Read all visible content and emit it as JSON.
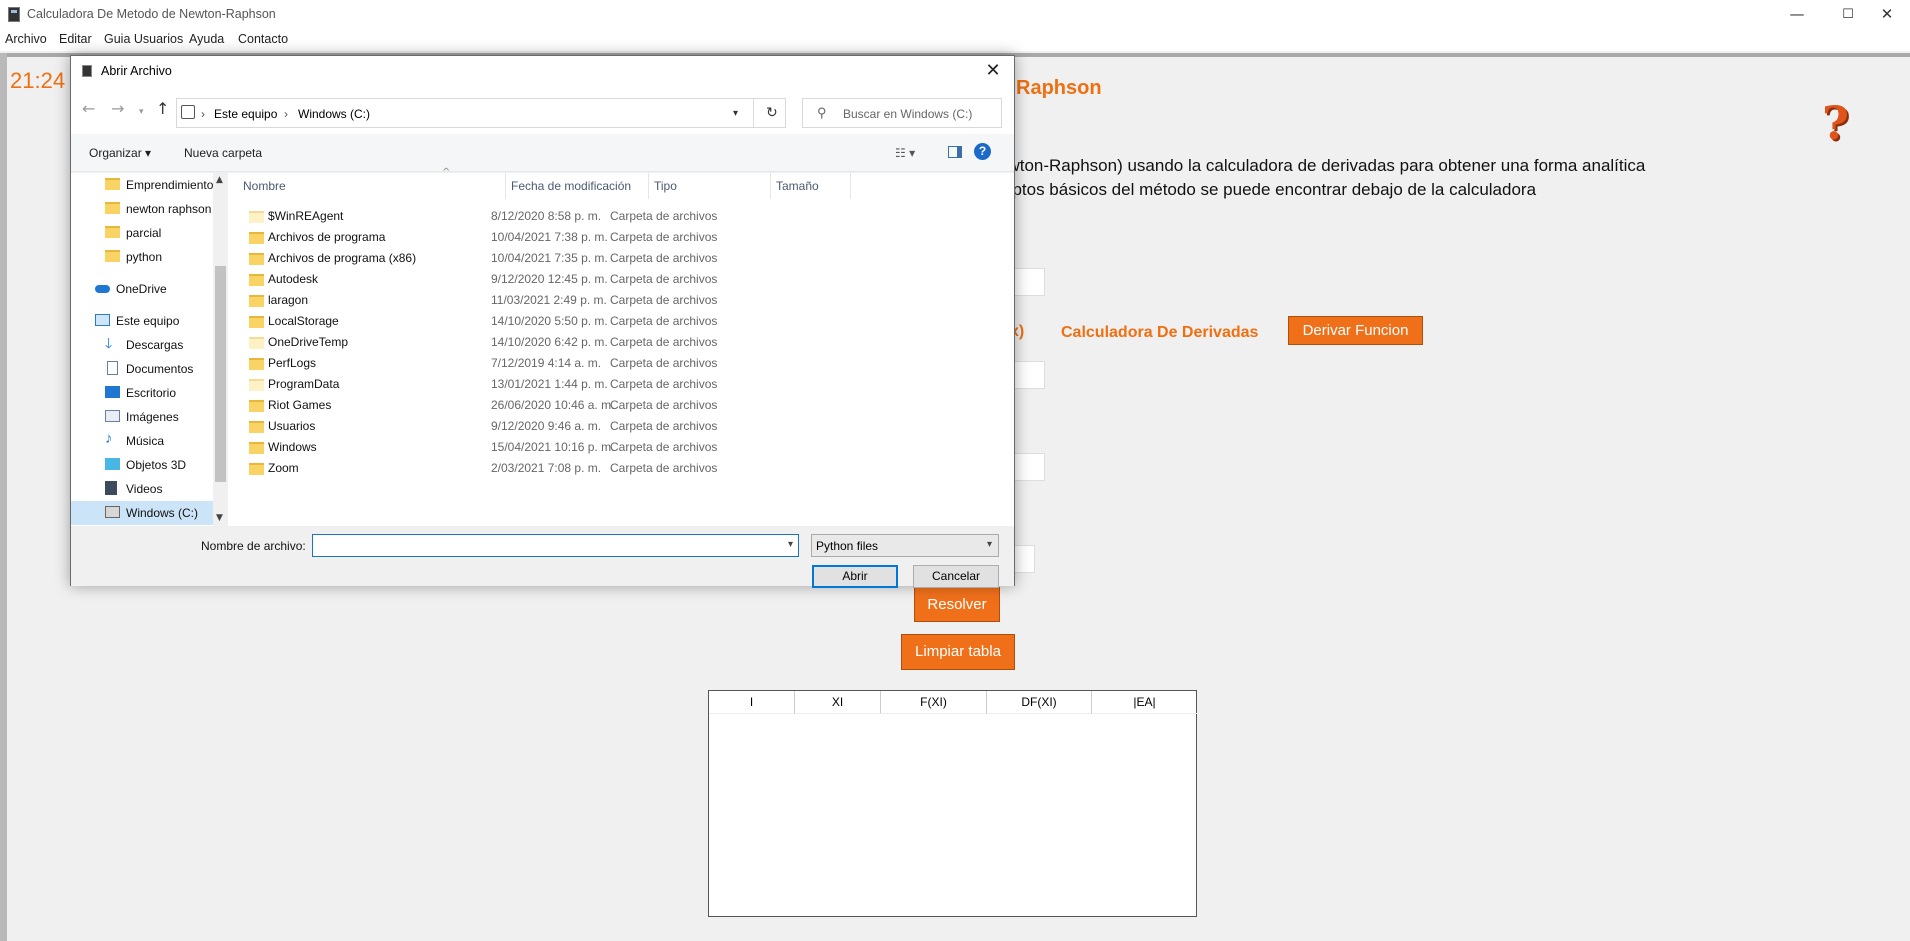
{
  "window": {
    "title": "Calculadora De Metodo de Newton-Raphson",
    "minimize": "—",
    "maximize": "☐",
    "close": "✕"
  },
  "menu": [
    "Archivo",
    "Editar",
    "Guia Usuarios",
    "Ayuda",
    "Contacto"
  ],
  "app": {
    "clock": "21:24",
    "heading_fragment": "Raphson",
    "help_symbol": "?",
    "desc_line1": "ewton-Raphson) usando  la calculadora de derivadas para obtener una forma analítica",
    "desc_line2": "eptos básicos del método se puede encontrar debajo de la calculadora",
    "fx_fragment": "x)",
    "derivative_calc_label": "Calculadora De Derivadas",
    "derive_button": "Derivar Funcion",
    "solve_button": "Resolver",
    "clear_button": "Limpiar tabla",
    "table_headers": [
      "I",
      "XI",
      "F(XI)",
      "DF(XI)",
      "|EA|"
    ]
  },
  "dialog": {
    "title": "Abrir Archivo",
    "close": "✕",
    "breadcrumb": [
      "Este equipo",
      "Windows (C:)"
    ],
    "search_placeholder": "Buscar en Windows (C:)",
    "organize": "Organizar ▾",
    "new_folder": "Nueva carpeta",
    "nav_items": [
      {
        "label": "Emprendimiento",
        "icon": "folder"
      },
      {
        "label": "newton raphson",
        "icon": "folder"
      },
      {
        "label": "parcial",
        "icon": "folder"
      },
      {
        "label": "python",
        "icon": "folder"
      },
      {
        "label": "OneDrive",
        "icon": "cloud"
      },
      {
        "label": "Este equipo",
        "icon": "computer"
      },
      {
        "label": "Descargas",
        "icon": "download"
      },
      {
        "label": "Documentos",
        "icon": "document"
      },
      {
        "label": "Escritorio",
        "icon": "desktop"
      },
      {
        "label": "Imágenes",
        "icon": "image"
      },
      {
        "label": "Música",
        "icon": "music"
      },
      {
        "label": "Objetos 3D",
        "icon": "cube"
      },
      {
        "label": "Videos",
        "icon": "video"
      },
      {
        "label": "Windows (C:)",
        "icon": "drive"
      }
    ],
    "columns": [
      "Nombre",
      "Fecha de modificación",
      "Tipo",
      "Tamaño"
    ],
    "files": [
      {
        "name": "$WinREAgent",
        "date": "8/12/2020 8:58 p. m.",
        "type": "Carpeta de archivos"
      },
      {
        "name": "Archivos de programa",
        "date": "10/04/2021 7:38 p. m.",
        "type": "Carpeta de archivos"
      },
      {
        "name": "Archivos de programa (x86)",
        "date": "10/04/2021 7:35 p. m.",
        "type": "Carpeta de archivos"
      },
      {
        "name": "Autodesk",
        "date": "9/12/2020 12:45 p. m.",
        "type": "Carpeta de archivos"
      },
      {
        "name": "laragon",
        "date": "11/03/2021 2:49 p. m.",
        "type": "Carpeta de archivos"
      },
      {
        "name": "LocalStorage",
        "date": "14/10/2020 5:50 p. m.",
        "type": "Carpeta de archivos"
      },
      {
        "name": "OneDriveTemp",
        "date": "14/10/2020 6:42 p. m.",
        "type": "Carpeta de archivos"
      },
      {
        "name": "PerfLogs",
        "date": "7/12/2019 4:14 a. m.",
        "type": "Carpeta de archivos"
      },
      {
        "name": "ProgramData",
        "date": "13/01/2021 1:44 p. m.",
        "type": "Carpeta de archivos"
      },
      {
        "name": "Riot Games",
        "date": "26/06/2020 10:46 a. m.",
        "type": "Carpeta de archivos"
      },
      {
        "name": "Usuarios",
        "date": "9/12/2020 9:46 a. m.",
        "type": "Carpeta de archivos"
      },
      {
        "name": "Windows",
        "date": "15/04/2021 10:16 p. m.",
        "type": "Carpeta de archivos"
      },
      {
        "name": "Zoom",
        "date": "2/03/2021 7:08 p. m.",
        "type": "Carpeta de archivos"
      }
    ],
    "filename_label": "Nombre de archivo:",
    "filename_value": "",
    "filetype": "Python files",
    "open_button": "Abrir",
    "cancel_button": "Cancelar"
  }
}
